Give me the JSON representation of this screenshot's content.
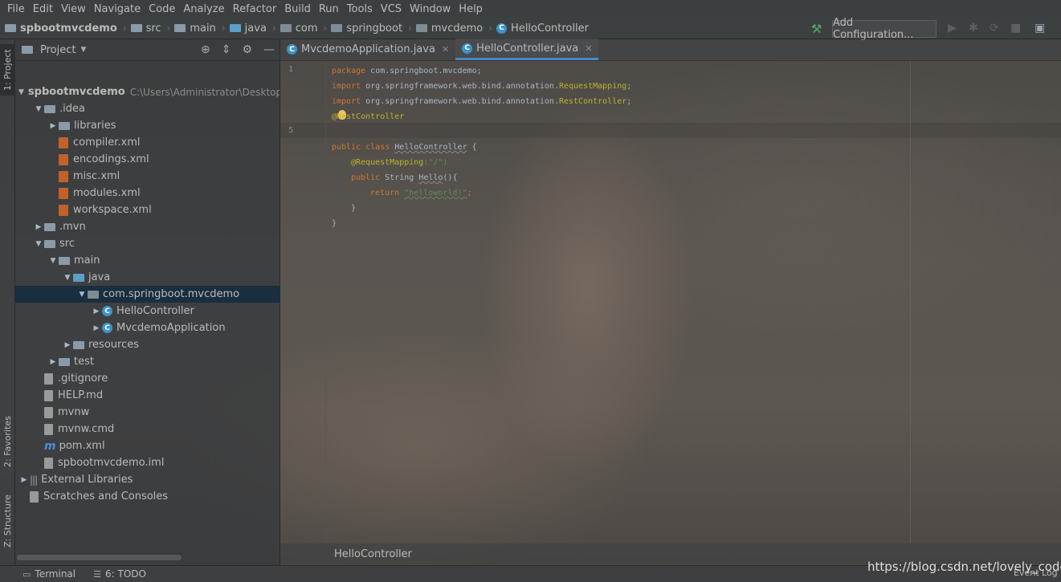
{
  "menu": [
    "File",
    "Edit",
    "View",
    "Navigate",
    "Code",
    "Analyze",
    "Refactor",
    "Build",
    "Run",
    "Tools",
    "VCS",
    "Window",
    "Help"
  ],
  "breadcrumbs": [
    "spbootmvcdemo",
    "src",
    "main",
    "java",
    "com",
    "springboot",
    "mvcdemo",
    "HelloController"
  ],
  "toolbar": {
    "add_config_label": "Add Configuration..."
  },
  "left_tool_tabs": {
    "project": "1: Project",
    "favorites": "2: Favorites",
    "structure": "Z: Structure"
  },
  "project_panel": {
    "title": "Project",
    "tree": [
      {
        "label": "spbootmvcdemo",
        "path": "C:\\Users\\Administrator\\Desktop",
        "icon": "folder-icon",
        "expanded": true,
        "level": 0
      },
      {
        "label": ".idea",
        "icon": "folder-icon",
        "expanded": true,
        "level": 1
      },
      {
        "label": "libraries",
        "icon": "folder-icon",
        "expanded": false,
        "level": 2
      },
      {
        "label": "compiler.xml",
        "icon": "xml-file-icon",
        "level": 2
      },
      {
        "label": "encodings.xml",
        "icon": "xml-file-icon",
        "level": 2
      },
      {
        "label": "misc.xml",
        "icon": "xml-file-icon",
        "level": 2
      },
      {
        "label": "modules.xml",
        "icon": "xml-file-icon",
        "level": 2
      },
      {
        "label": "workspace.xml",
        "icon": "xml-file-icon",
        "level": 2
      },
      {
        "label": ".mvn",
        "icon": "folder-icon",
        "expanded": false,
        "level": 1
      },
      {
        "label": "src",
        "icon": "folder-icon",
        "expanded": true,
        "level": 1
      },
      {
        "label": "main",
        "icon": "folder-icon",
        "expanded": true,
        "level": 2
      },
      {
        "label": "java",
        "icon": "source-folder-icon",
        "expanded": true,
        "level": 3
      },
      {
        "label": "com.springboot.mvcdemo",
        "icon": "package-icon",
        "expanded": true,
        "level": 4,
        "selected": true
      },
      {
        "label": "HelloController",
        "icon": "class-icon",
        "expanded": false,
        "level": 5
      },
      {
        "label": "MvcdemoApplication",
        "icon": "class-icon",
        "expanded": false,
        "level": 5
      },
      {
        "label": "resources",
        "icon": "resources-folder-icon",
        "expanded": false,
        "level": 3
      },
      {
        "label": "test",
        "icon": "folder-icon",
        "expanded": false,
        "level": 2
      },
      {
        "label": ".gitignore",
        "icon": "file-icon",
        "level": 1
      },
      {
        "label": "HELP.md",
        "icon": "file-icon",
        "level": 1
      },
      {
        "label": "mvnw",
        "icon": "file-icon",
        "level": 1
      },
      {
        "label": "mvnw.cmd",
        "icon": "file-icon",
        "level": 1
      },
      {
        "label": "pom.xml",
        "icon": "maven-icon",
        "level": 1
      },
      {
        "label": "spbootmvcdemo.iml",
        "icon": "file-icon",
        "level": 1
      },
      {
        "label": "External Libraries",
        "icon": "library-icon",
        "expanded": false,
        "level": 0
      },
      {
        "label": "Scratches and Consoles",
        "icon": "scratches-icon",
        "level": 0
      }
    ]
  },
  "editor": {
    "tabs": [
      {
        "label": "MvcdemoApplication.java",
        "active": false
      },
      {
        "label": "HelloController.java",
        "active": true
      }
    ],
    "line_numbers": [
      "1",
      "5"
    ],
    "code": {
      "l1_kw": "package",
      "l1_pkg": " com.springboot.mvcdemo;",
      "l2_kw": "import",
      "l2_pkg": " org.springframework.web.bind.annotation.",
      "l2_ann": "RequestMapping",
      "l2_end": ";",
      "l3_kw": "import",
      "l3_pkg": " org.springframework.web.bind.annotation.",
      "l3_ann": "RestController",
      "l3_end": ";",
      "l4": "@RestController",
      "l6_kw": "public class ",
      "l6_ident": "HelloController",
      "l6_end": " {",
      "l7_ann": "@RequestMapping",
      "l7_str": "(\"/\")",
      "l8_kw": "public",
      "l8_plain": " String ",
      "l8_ident": "Hello",
      "l8_end": "(){",
      "l9_kw": "return ",
      "l9_str": "\"helloworld!\"",
      "l9_end": ";",
      "l10": "}",
      "l11": "}"
    },
    "bottom_breadcrumb": "HelloController"
  },
  "statusbar": {
    "terminal": "Terminal",
    "todo": "6: TODO",
    "event_log": "Event Log",
    "watermark": "https://blog.csdn.net/lovely_code"
  },
  "colors": {
    "accent": "#4a88c7",
    "keyword": "#cc7832",
    "annotation": "#bbb529",
    "string": "#6a8759",
    "selection": "#0d293e"
  }
}
